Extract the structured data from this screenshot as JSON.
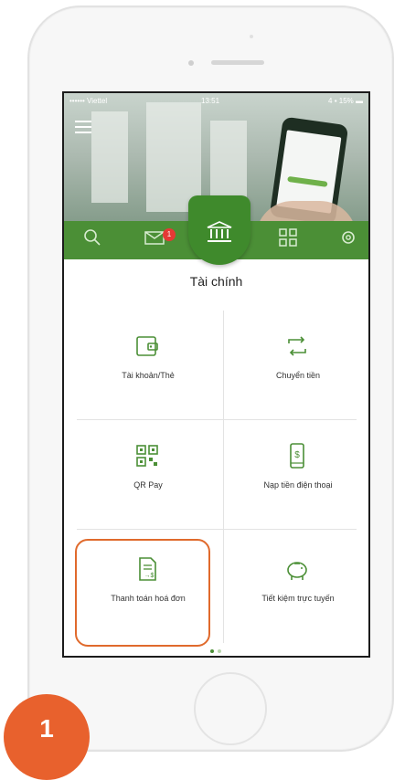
{
  "status_bar": {
    "carrier": "•••••• Viettel",
    "time": "13:51",
    "battery": "4 ▪ 15% ▬"
  },
  "nav": {
    "icons": [
      "search-icon",
      "mail-icon",
      "bank-icon",
      "grid-icon",
      "settings-icon"
    ],
    "mail_badge": "1",
    "accent": "#4b8f36"
  },
  "section_title": "Tài chính",
  "tiles": [
    {
      "label": "Tài khoản/Thẻ",
      "icon": "wallet-icon"
    },
    {
      "label": "Chuyển tiền",
      "icon": "transfer-icon"
    },
    {
      "label": "QR Pay",
      "icon": "qr-icon"
    },
    {
      "label": "Nạp tiền điện thoại",
      "icon": "phone-topup-icon"
    },
    {
      "label": "Thanh toán hoá đơn",
      "icon": "bill-icon"
    },
    {
      "label": "Tiết kiệm trực tuyến",
      "icon": "piggy-bank-icon"
    }
  ],
  "pager": {
    "active": 1,
    "count": 2
  },
  "step_number": "1",
  "highlight_color": "#e06a2c"
}
